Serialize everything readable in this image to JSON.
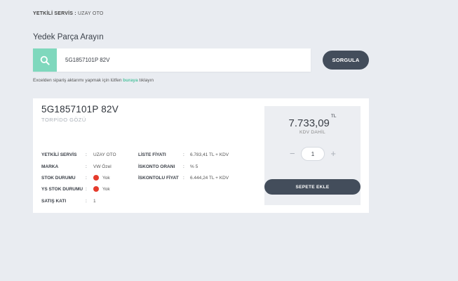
{
  "header": {
    "auth_label": "YETKİLİ SERVİS :",
    "auth_value": "UZAY OTO"
  },
  "search": {
    "title": "Yedek Parça Arayın",
    "value": "5G1857101P 82V",
    "button_label": "SORGULA",
    "excel_note_before": "Excelden sipariş aktarımı yapmak için lütfen",
    "excel_link": "buraya",
    "excel_note_after": "tıklayın"
  },
  "result": {
    "part_code": "5G1857101P 82V",
    "part_desc": "TORPİDO GÖZÜ",
    "left_fields": [
      {
        "label": "YETKİLİ SERVİS",
        "value": "UZAY OTO"
      },
      {
        "label": "MARKA",
        "value": "VW Özel"
      },
      {
        "label": "STOK DURUMU",
        "value": "Yok"
      },
      {
        "label": "YS STOK DURUMU",
        "value": "Yok"
      },
      {
        "label": "SATIŞ KATI",
        "value": "1"
      }
    ],
    "right_fields": [
      {
        "label": "LİSTE FİYATI",
        "value": "6.783,41 TL + KDV"
      },
      {
        "label": "İSKONTO ORANI",
        "value": "% 5"
      },
      {
        "label": "İSKONTOLU FİYAT",
        "value": "6.444,24 TL + KDV"
      }
    ],
    "price": "7.733,09",
    "currency": "TL",
    "kdv_note": "KDV DAHİL",
    "quantity": "1",
    "minus": "−",
    "plus": "+",
    "cart_button": "SEPETE EKLE"
  },
  "colors": {
    "accent": "#7fd8bd",
    "dark_button": "#434d5b",
    "status_red": "#e53b2c"
  },
  "icons": {
    "search": "search-icon"
  }
}
